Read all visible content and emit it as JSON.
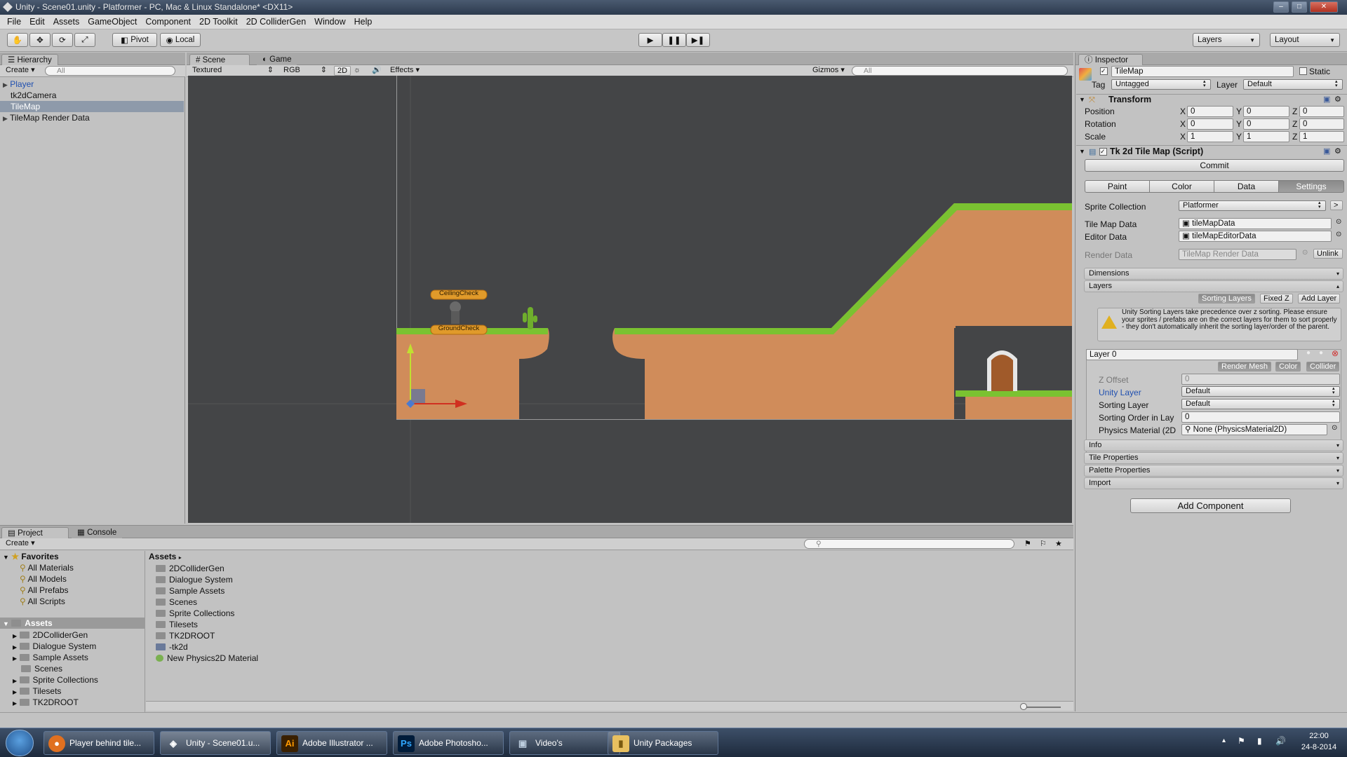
{
  "window": {
    "title": "Unity - Scene01.unity - Platformer - PC, Mac & Linux Standalone* <DX11>"
  },
  "menu": [
    "File",
    "Edit",
    "Assets",
    "GameObject",
    "Component",
    "2D Toolkit",
    "2D ColliderGen",
    "Window",
    "Help"
  ],
  "toolbar": {
    "pivot": "Pivot",
    "local": "Local",
    "layers": "Layers",
    "layout": "Layout"
  },
  "hierarchy": {
    "tab": "Hierarchy",
    "create": "Create",
    "search_placeholder": "All",
    "items": [
      {
        "label": "Player",
        "selected": false
      },
      {
        "label": "tk2dCamera"
      },
      {
        "label": "TileMap",
        "selected": true
      },
      {
        "label": "TileMap Render Data"
      }
    ]
  },
  "scene_view": {
    "tabs": [
      "Scene",
      "Game"
    ],
    "shading": "Textured",
    "color_mode": "RGB",
    "mode_2d": "2D",
    "effects": "Effects",
    "gizmos": "Gizmos",
    "search_placeholder": "All",
    "labels": {
      "ceiling": "CeilingCheck",
      "ground": "GroundCheck"
    },
    "colors": {
      "grass": "#7ac231",
      "dirt": "#d08c5a",
      "background": "#444547"
    }
  },
  "inspector": {
    "tab": "Inspector",
    "object_name": "TileMap",
    "static": "Static",
    "tag_label": "Tag",
    "tag_value": "Untagged",
    "layer_label": "Layer",
    "layer_value": "Default",
    "transform": {
      "title": "Transform",
      "rows": [
        {
          "label": "Position",
          "x": "0",
          "y": "0",
          "z": "0"
        },
        {
          "label": "Rotation",
          "x": "0",
          "y": "0",
          "z": "0"
        },
        {
          "label": "Scale",
          "x": "1",
          "y": "1",
          "z": "1"
        }
      ]
    },
    "tilemap": {
      "title": "Tk 2d Tile Map (Script)",
      "commit": "Commit",
      "tabs": [
        "Paint",
        "Color",
        "Data",
        "Settings"
      ],
      "sprite_collection_label": "Sprite Collection",
      "sprite_collection": "Platformer",
      "tile_map_data_label": "Tile Map Data",
      "tile_map_data": "tileMapData",
      "editor_data_label": "Editor Data",
      "editor_data": "tileMapEditorData",
      "render_data_label": "Render Data",
      "render_data": "TileMap Render Data",
      "unlink": "Unlink",
      "dimensions": "Dimensions",
      "layers": "Layers",
      "sorting_layers": "Sorting Layers",
      "fixed_z": "Fixed Z",
      "add_layer": "Add Layer",
      "warning": "Unity Sorting Layers take precedence over z sorting. Please ensure your sprites / prefabs are on the correct layers for them to sort properly - they don't automatically inherit the sorting layer/order of the parent.",
      "layer_name": "Layer 0",
      "render_mesh": "Render Mesh",
      "color": "Color",
      "collider": "Collider",
      "z_offset_label": "Z Offset",
      "z_offset": "0",
      "unity_layer_label": "Unity Layer",
      "unity_layer": "Default",
      "sorting_layer_label": "Sorting Layer",
      "sorting_layer": "Default",
      "sorting_order_label": "Sorting Order in Lay",
      "sorting_order": "0",
      "physics_material_label": "Physics Material (2D",
      "physics_material": "None (PhysicsMaterial2D)",
      "info": "Info",
      "tile_properties": "Tile Properties",
      "palette_properties": "Palette Properties",
      "import": "Import"
    },
    "add_component": "Add Component"
  },
  "project": {
    "tabs": [
      "Project",
      "Console"
    ],
    "create": "Create",
    "favorites_label": "Favorites",
    "favorites": [
      "All Materials",
      "All Models",
      "All Prefabs",
      "All Scripts"
    ],
    "assets_label": "Assets",
    "tree": [
      "2DColliderGen",
      "Dialogue System",
      "Sample Assets",
      "Scenes",
      "Sprite Collections",
      "Tilesets",
      "TK2DROOT"
    ],
    "breadcrumb": "Assets",
    "files": [
      "2DColliderGen",
      "Dialogue System",
      "Sample Assets",
      "Scenes",
      "Sprite Collections",
      "Tilesets",
      "TK2DROOT",
      "-tk2d",
      "New Physics2D Material"
    ]
  },
  "taskbar": {
    "items": [
      "Player behind tile...",
      "Unity - Scene01.u...",
      "Adobe Illustrator ...",
      "Adobe Photosho...",
      "Video's",
      "Unity Packages"
    ],
    "time": "22:00",
    "date": "24-8-2014"
  }
}
